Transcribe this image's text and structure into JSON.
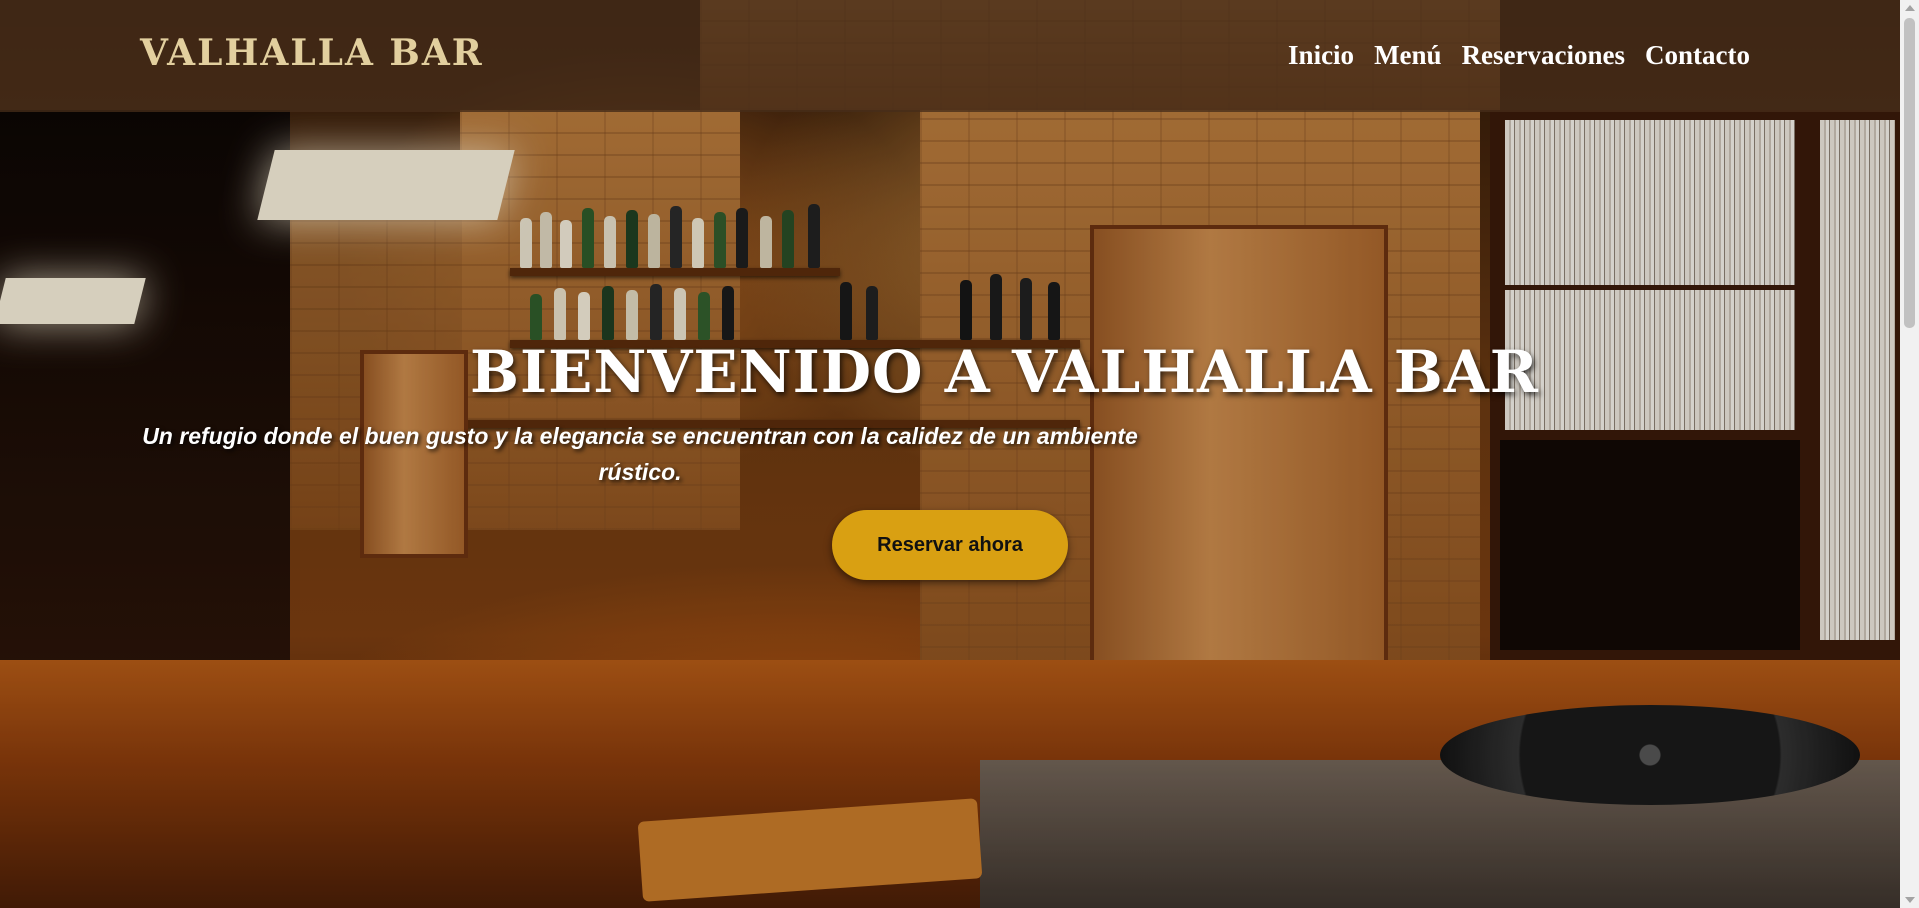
{
  "navbar": {
    "brand": "VALHALLA BAR",
    "links": [
      "Inicio",
      "Menú",
      "Reservaciones",
      "Contacto"
    ]
  },
  "hero": {
    "title": "BIENVENIDO A VALHALLA BAR",
    "subtitle": "Un refugio donde el buen gusto y la elegancia se encuentran con la calidez de un ambiente rústico.",
    "cta_label": "Reservar ahora",
    "background": "bar-interior-photo"
  },
  "colors": {
    "accent": "#d9a012",
    "brand_text": "#e2cf9e",
    "navbar_bg": "#462d19"
  }
}
